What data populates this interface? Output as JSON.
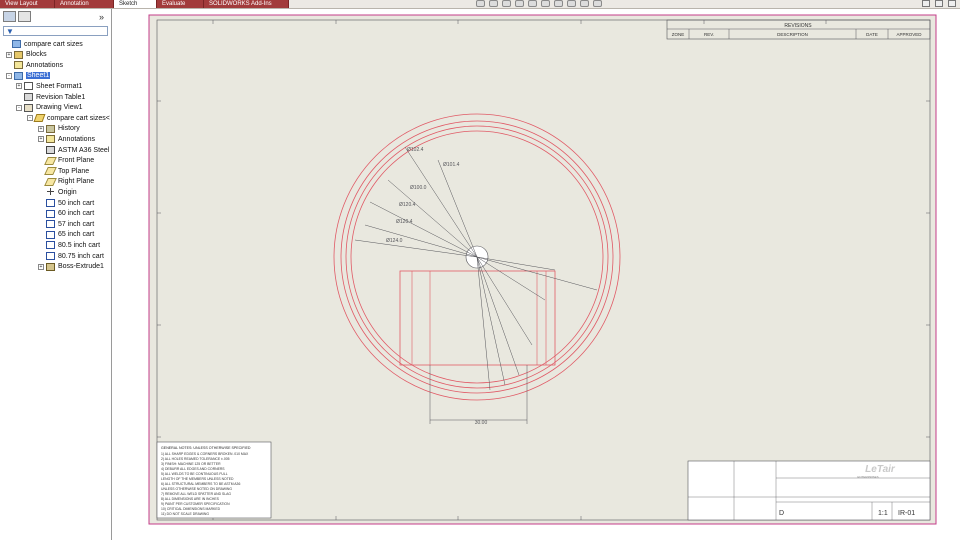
{
  "top_tabs": [
    {
      "label": "View Layout",
      "active": false
    },
    {
      "label": "Annotation",
      "active": false
    },
    {
      "label": "Sketch",
      "active": true
    },
    {
      "label": "Evaluate",
      "active": false
    },
    {
      "label": "SOLIDWORKS Add-Ins",
      "active": false
    }
  ],
  "panel": {
    "collapse_glyph": "»",
    "filter_glyph": "▼",
    "tree": [
      {
        "depth": 0,
        "expander": "",
        "icon": "drawing",
        "label": "compare cart sizes"
      },
      {
        "depth": 1,
        "expander": "+",
        "icon": "blocks",
        "label": "Blocks"
      },
      {
        "depth": 1,
        "expander": "",
        "icon": "annotations",
        "label": "Annotations"
      },
      {
        "depth": 1,
        "expander": "-",
        "icon": "sheet",
        "label": "Sheet1",
        "selected": true
      },
      {
        "depth": 2,
        "expander": "+",
        "icon": "sheet-format",
        "label": "Sheet Format1"
      },
      {
        "depth": 2,
        "expander": "",
        "icon": "table",
        "label": "Revision Table1"
      },
      {
        "depth": 2,
        "expander": "-",
        "icon": "drawing-view",
        "label": "Drawing View1"
      },
      {
        "depth": 3,
        "expander": "-",
        "icon": "part",
        "label": "compare cart sizes<"
      },
      {
        "depth": 4,
        "expander": "+",
        "icon": "history",
        "label": "History"
      },
      {
        "depth": 4,
        "expander": "+",
        "icon": "annotations",
        "label": "Annotations"
      },
      {
        "depth": 4,
        "expander": "",
        "icon": "material",
        "label": "ASTM A36 Steel"
      },
      {
        "depth": 4,
        "expander": "",
        "icon": "plane",
        "label": "Front Plane"
      },
      {
        "depth": 4,
        "expander": "",
        "icon": "plane",
        "label": "Top Plane"
      },
      {
        "depth": 4,
        "expander": "",
        "icon": "plane",
        "label": "Right Plane"
      },
      {
        "depth": 4,
        "expander": "",
        "icon": "origin",
        "label": "Origin"
      },
      {
        "depth": 4,
        "expander": "",
        "icon": "sketch",
        "label": "50 inch cart"
      },
      {
        "depth": 4,
        "expander": "",
        "icon": "sketch",
        "label": "60 inch cart"
      },
      {
        "depth": 4,
        "expander": "",
        "icon": "sketch",
        "label": "57 inch cart"
      },
      {
        "depth": 4,
        "expander": "",
        "icon": "sketch",
        "label": "65 inch cart"
      },
      {
        "depth": 4,
        "expander": "",
        "icon": "sketch",
        "label": "80.5 inch cart"
      },
      {
        "depth": 4,
        "expander": "",
        "icon": "sketch",
        "label": "80.75 inch cart"
      },
      {
        "depth": 4,
        "expander": "+",
        "icon": "extrude",
        "label": "Boss-Extrude1"
      }
    ]
  },
  "revisions": {
    "title": "REVISIONS",
    "headers": [
      "ZONE",
      "REV.",
      "DESCRIPTION",
      "DATE",
      "APPROVED"
    ]
  },
  "dimensions": [
    {
      "label": "Ø102.4"
    },
    {
      "label": "Ø101.4"
    },
    {
      "label": "Ø100.0"
    },
    {
      "label": "Ø120.4"
    },
    {
      "label": "Ø120.4"
    },
    {
      "label": "Ø124.0"
    },
    {
      "label": "30.00"
    }
  ],
  "notes": {
    "title": "GENERAL NOTES: UNLESS OTHERWISE SPECIFIED",
    "lines": [
      "1) ALL SHARP EDGES & CORNERS BROKEN .010 MAX",
      "2) ALL HOLES REAMED TOLERANCE ±.005",
      "3) FINISH: MACHINE 125 OR BETTER",
      "4) DEBURR ALL EDGES AND CORNERS",
      "5) ALL WELDS TO BE CONTINUOUS FULL",
      "   LENGTH OF THE MEMBERS UNLESS NOTED",
      "6) ALL STRUCTURAL MEMBERS TO BE ASTM A36",
      "   UNLESS OTHERWISE NOTED ON DRAWING",
      "7) REMOVE ALL WELD SPATTER AND SLAG",
      "8) ALL DIMENSIONS ARE IN INCHES",
      "9) PAINT PER CUSTOMER SPECIFICATION",
      "10) CRITICAL DIMENSIONS MARKED",
      "11) DO NOT SCALE DRAWING"
    ]
  },
  "titleblock": {
    "logo": "LeTair",
    "subtitle": "ENTERPRISES",
    "size": "D",
    "scale_label": "1:1",
    "dwg_no": "IR-01"
  },
  "colors": {
    "sheet_bg": "#e9e8df",
    "border": "#c43c8a",
    "geometry": "#e05a66",
    "dims": "#55555a",
    "window_bg": "#ffffff"
  }
}
